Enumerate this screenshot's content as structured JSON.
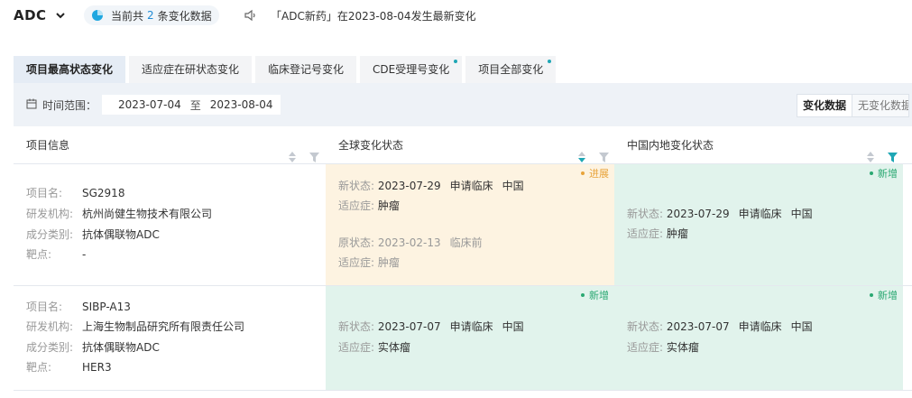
{
  "header": {
    "product": "ADC",
    "count_prefix": "当前共",
    "count": "2",
    "count_suffix": "条变化数据",
    "notice": "「ADC新药」在2023-08-04发生最新变化"
  },
  "tabs": [
    {
      "label": "项目最高状态变化",
      "active": true
    },
    {
      "label": "适应症在研状态变化"
    },
    {
      "label": "临床登记号变化"
    },
    {
      "label": "CDE受理号变化",
      "badge": true
    },
    {
      "label": "项目全部变化",
      "badge": true
    }
  ],
  "filter": {
    "label": "时间范围：",
    "start": "2023-07-04",
    "sep": "至",
    "end": "2023-08-04",
    "toggle_on": "变化数据",
    "toggle_off": "无变化数据"
  },
  "columns": {
    "info": "项目信息",
    "global": "全球变化状态",
    "cn": "中国内地变化状态"
  },
  "field_labels": {
    "name": "项目名:",
    "org": "研发机构:",
    "type": "成分类别:",
    "target": "靶点:",
    "new_status": "新状态:",
    "indication": "适应症:",
    "old_status": "原状态:"
  },
  "rows": [
    {
      "name": "SG2918",
      "org": "杭州尚健生物技术有限公司",
      "type": "抗体偶联物ADC",
      "target": "-",
      "global": {
        "tag": "进展",
        "new_date": "2023-07-29",
        "new_phase": "申请临床",
        "new_region": "中国",
        "new_indication": "肿瘤",
        "old_date": "2023-02-13",
        "old_phase": "临床前",
        "old_indication": "肿瘤"
      },
      "cn": {
        "tag": "新增",
        "new_date": "2023-07-29",
        "new_phase": "申请临床",
        "new_region": "中国",
        "new_indication": "肿瘤"
      }
    },
    {
      "name": "SIBP-A13",
      "org": "上海生物制品研究所有限责任公司",
      "type": "抗体偶联物ADC",
      "target": "HER3",
      "global": {
        "tag": "新增",
        "new_date": "2023-07-07",
        "new_phase": "申请临床",
        "new_region": "中国",
        "new_indication": "实体瘤"
      },
      "cn": {
        "tag": "新增",
        "new_date": "2023-07-07",
        "new_phase": "申请临床",
        "new_region": "中国",
        "new_indication": "实体瘤"
      }
    }
  ],
  "colors": {
    "accent": "#1f8bd6",
    "progress_bg": "#fdf3e1",
    "new_bg": "#e1f3ec",
    "progress_tag": "#e8a33a",
    "new_tag": "#2aa872",
    "active_filter": "#1fa7b5"
  },
  "icons": [
    "chevron-down-icon",
    "pie-chart-icon",
    "speaker-icon",
    "calendar-icon",
    "sort-icon",
    "filter-icon"
  ]
}
